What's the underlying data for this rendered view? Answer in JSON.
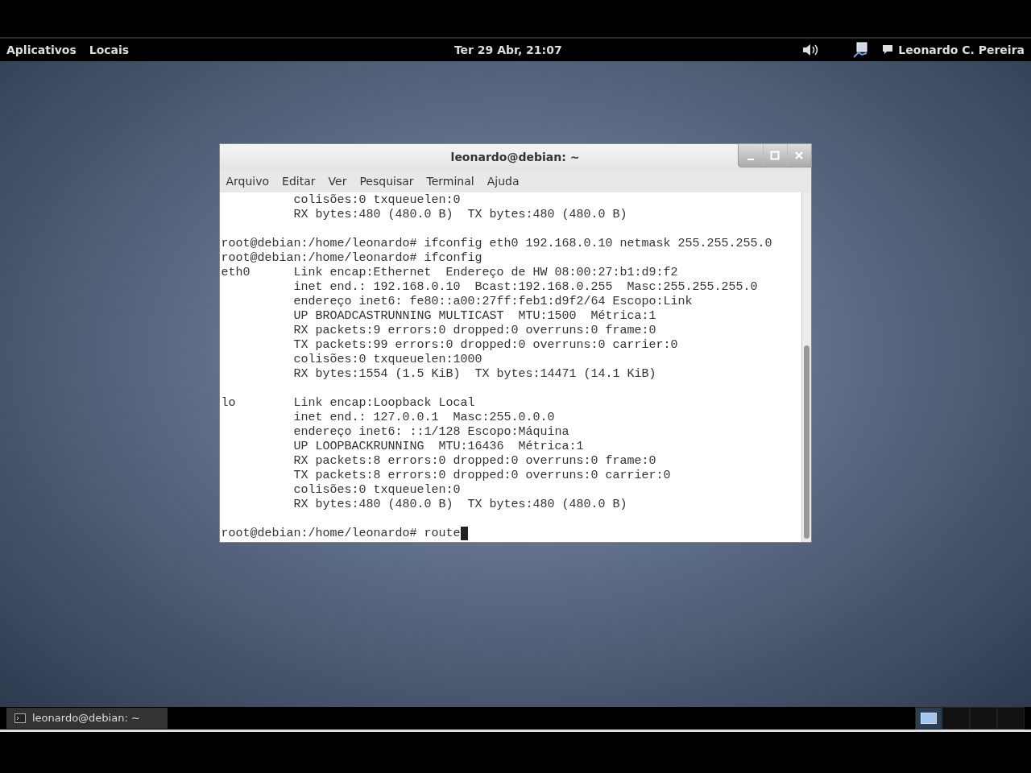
{
  "top_panel": {
    "menus": [
      "Aplicativos",
      "Locais"
    ],
    "clock": "Ter 29 Abr, 21:07",
    "user": "Leonardo C. Pereira"
  },
  "window": {
    "title": "leonardo@debian: ~",
    "menu": [
      "Arquivo",
      "Editar",
      "Ver",
      "Pesquisar",
      "Terminal",
      "Ajuda"
    ],
    "blocks": [
      [
        "          colisões:0 txqueuelen:0",
        "          RX bytes:480 (480.0 B)  TX bytes:480 (480.0 B)"
      ],
      [
        "root@debian:/home/leonardo# ifconfig eth0 192.168.0.10 netmask 255.255.255.0",
        "root@debian:/home/leonardo# ifconfig",
        "eth0      Link encap:Ethernet  Endereço de HW 08:00:27:b1:d9:f2",
        "          inet end.: 192.168.0.10  Bcast:192.168.0.255  Masc:255.255.255.0",
        "          endereço inet6: fe80::a00:27ff:feb1:d9f2/64 Escopo:Link",
        "          UP BROADCASTRUNNING MULTICAST  MTU:1500  Métrica:1",
        "          RX packets:9 errors:0 dropped:0 overruns:0 frame:0",
        "          TX packets:99 errors:0 dropped:0 overruns:0 carrier:0",
        "          colisões:0 txqueuelen:1000",
        "          RX bytes:1554 (1.5 KiB)  TX bytes:14471 (14.1 KiB)"
      ],
      [
        "lo        Link encap:Loopback Local",
        "          inet end.: 127.0.0.1  Masc:255.0.0.0",
        "          endereço inet6: ::1/128 Escopo:Máquina",
        "          UP LOOPBACKRUNNING  MTU:16436  Métrica:1",
        "          RX packets:8 errors:0 dropped:0 overruns:0 frame:0",
        "          TX packets:8 errors:0 dropped:0 overruns:0 carrier:0",
        "          colisões:0 txqueuelen:0",
        "          RX bytes:480 (480.0 B)  TX bytes:480 (480.0 B)"
      ],
      [
        "root@debian:/home/leonardo# route"
      ]
    ],
    "cursor": true
  },
  "bottom_panel": {
    "tasks": [
      {
        "label": "leonardo@debian: ~",
        "selected": true
      }
    ],
    "workspaces": [
      {
        "selected": true
      },
      {
        "selected": false
      },
      {
        "selected": false
      },
      {
        "selected": false
      }
    ]
  }
}
